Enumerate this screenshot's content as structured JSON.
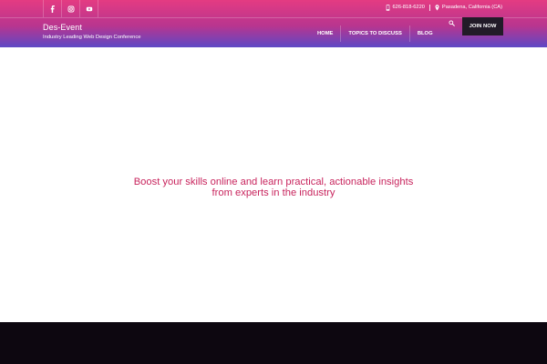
{
  "header": {
    "social": [
      {
        "icon": "facebook-icon"
      },
      {
        "icon": "instagram-icon"
      },
      {
        "icon": "youtube-icon"
      }
    ],
    "contact": {
      "phone_icon": "phone-icon",
      "phone": "626-818-6220",
      "location_icon": "location-pin-icon",
      "location": "Pasadena, California (CA)"
    },
    "brand": {
      "title": "Des-Event",
      "tagline": "Industry Leading Web Design Conference"
    },
    "nav": {
      "items": [
        {
          "label": "HOME"
        },
        {
          "label": "TOPICS TO DISCUSS"
        },
        {
          "label": "BLOG"
        }
      ]
    },
    "search_icon": "search-icon",
    "join_label": "JOIN NOW"
  },
  "hero": {
    "lines": [
      "Boost your skills online and learn practical, actionable insights",
      "from experts in the industry"
    ]
  },
  "colors": {
    "header_gradient_top": "#e43b82",
    "header_gradient_bottom": "#5d48c5",
    "hero_text": "#c8245d",
    "join_button": "#221b28",
    "bottom_band": "#0d0710"
  }
}
